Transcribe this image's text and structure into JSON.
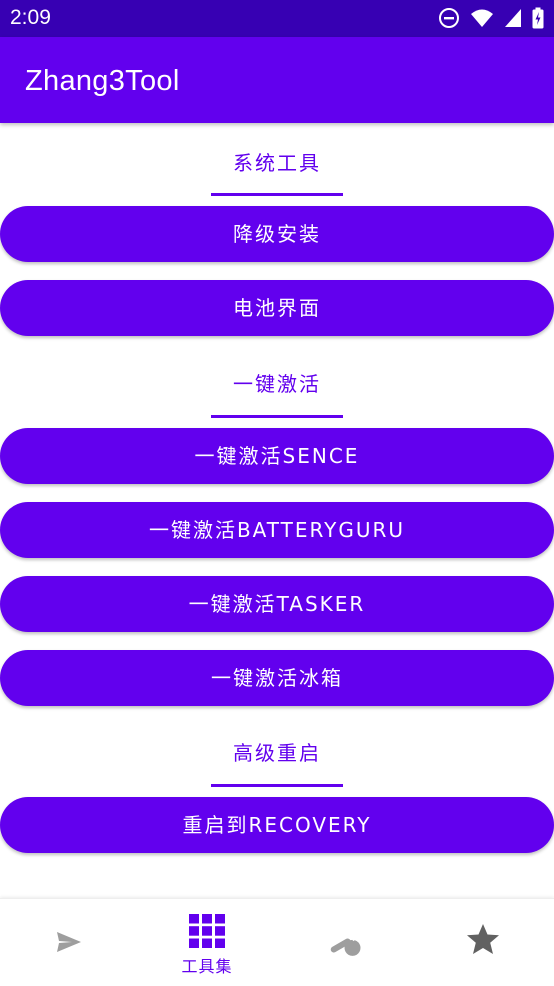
{
  "status_bar": {
    "time": "2:09"
  },
  "app_bar": {
    "title": "Zhang3Tool"
  },
  "sections": [
    {
      "header": "系统工具",
      "buttons": [
        "降级安装",
        "电池界面"
      ]
    },
    {
      "header": "一键激活",
      "buttons": [
        "一键激活SENCE",
        "一键激活BATTERYGURU",
        "一键激活TASKER",
        "一键激活冰箱"
      ]
    },
    {
      "header": "高级重启",
      "buttons": [
        "重启到RECOVERY"
      ]
    }
  ],
  "bottom_nav": {
    "items": [
      {
        "icon": "send-icon",
        "label": ""
      },
      {
        "icon": "grid-icon",
        "label": "工具集",
        "active": true
      },
      {
        "icon": "wrench-icon",
        "label": ""
      },
      {
        "icon": "star-icon",
        "label": ""
      }
    ]
  },
  "colors": {
    "primary": "#6200ee",
    "status_bar": "#3700b3",
    "inactive_icon": "#9e9e9e",
    "star": "#616161"
  }
}
